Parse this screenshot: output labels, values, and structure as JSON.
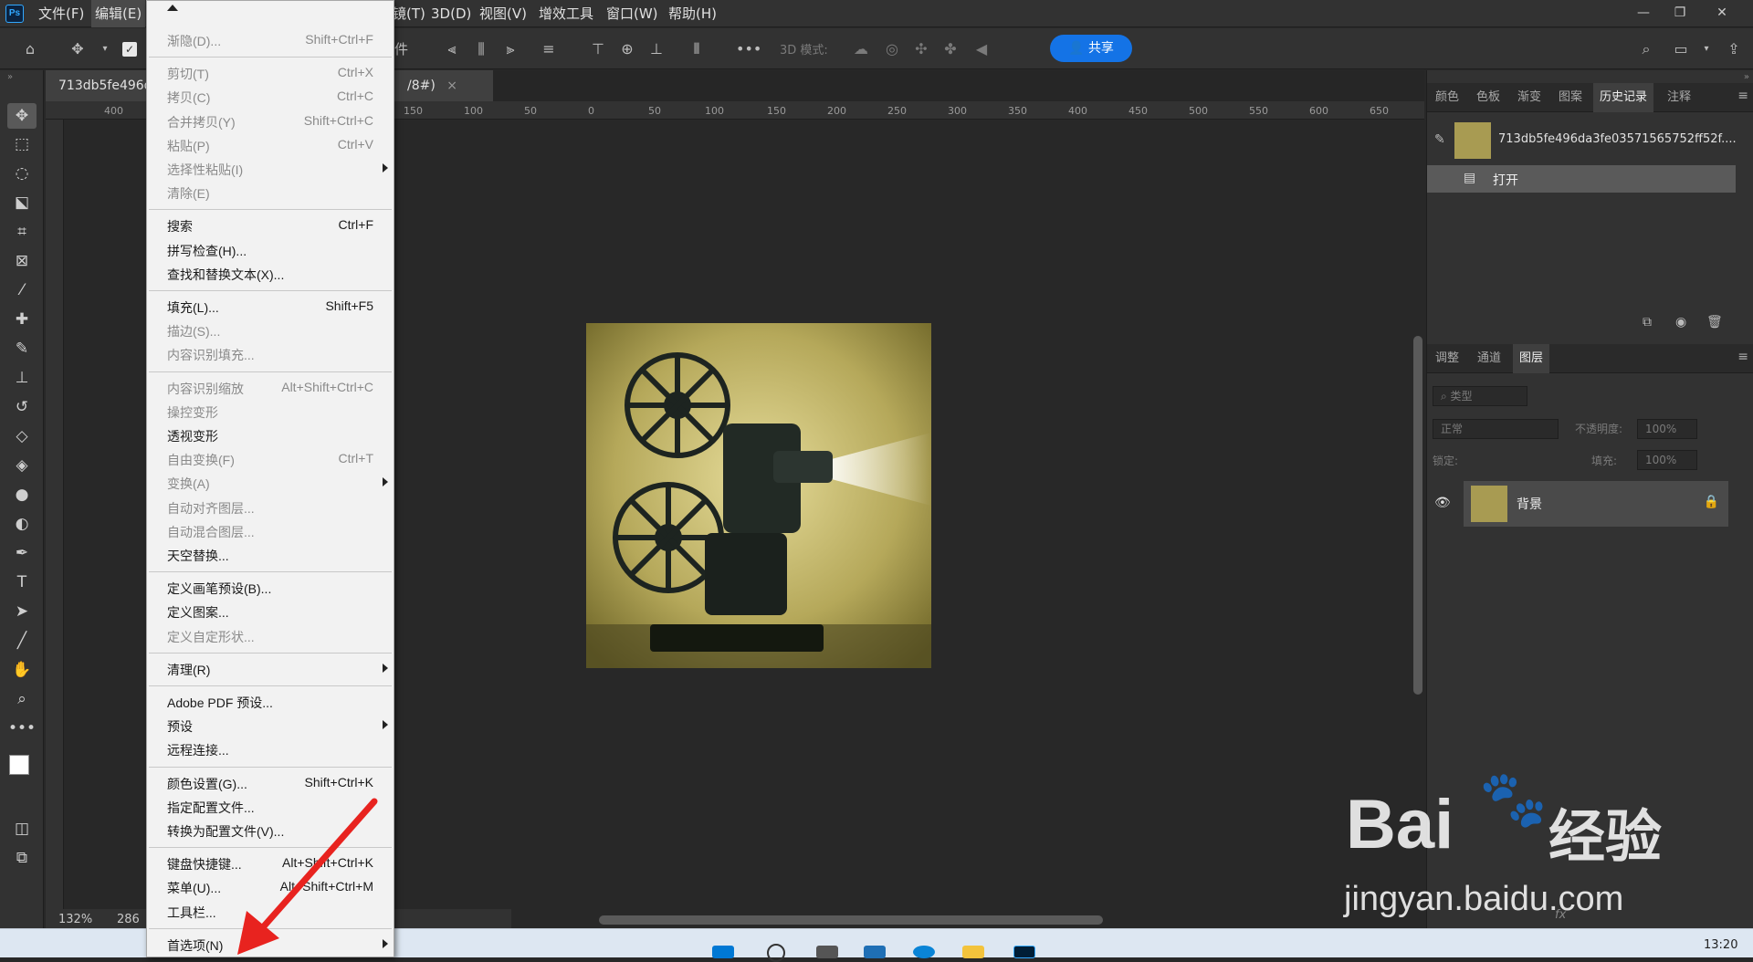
{
  "app": {
    "logo": "Ps"
  },
  "menubar": {
    "items": [
      "文件(F)",
      "编辑(E)",
      "滤镜(T)",
      "3D(D)",
      "视图(V)",
      "增效工具",
      "窗口(W)",
      "帮助(H)"
    ],
    "partial_item": "镜(T)"
  },
  "window_controls": {
    "minimize": "—",
    "restore": "❐",
    "close": "✕"
  },
  "options_bar": {
    "partial_text": "件",
    "mode_label": "3D 模式:",
    "share_label": "共享"
  },
  "document_tab": {
    "title_start": "713db5fe496d",
    "title_end": "/8#)",
    "close": "×"
  },
  "ruler": {
    "h_ticks": [
      "400",
      "350",
      "150",
      "100",
      "50",
      "0",
      "50",
      "100",
      "150",
      "200",
      "250",
      "300",
      "350",
      "400",
      "450",
      "500",
      "550",
      "600",
      "650"
    ]
  },
  "status": {
    "zoom": "132%",
    "size_partial": "286"
  },
  "dropdown": {
    "items": [
      {
        "label": "渐隐(D)...",
        "shortcut": "Shift+Ctrl+F",
        "disabled": true
      },
      {
        "sep": true
      },
      {
        "label": "剪切(T)",
        "shortcut": "Ctrl+X",
        "disabled": true
      },
      {
        "label": "拷贝(C)",
        "shortcut": "Ctrl+C",
        "disabled": true
      },
      {
        "label": "合并拷贝(Y)",
        "shortcut": "Shift+Ctrl+C",
        "disabled": true
      },
      {
        "label": "粘贴(P)",
        "shortcut": "Ctrl+V",
        "disabled": true
      },
      {
        "label": "选择性粘贴(I)",
        "shortcut": "",
        "disabled": true,
        "submenu": true
      },
      {
        "label": "清除(E)",
        "shortcut": "",
        "disabled": true
      },
      {
        "sep": true
      },
      {
        "label": "搜索",
        "shortcut": "Ctrl+F",
        "disabled": false
      },
      {
        "label": "拼写检查(H)...",
        "shortcut": "",
        "disabled": false
      },
      {
        "label": "查找和替换文本(X)...",
        "shortcut": "",
        "disabled": false
      },
      {
        "sep": true
      },
      {
        "label": "填充(L)...",
        "shortcut": "Shift+F5",
        "disabled": false
      },
      {
        "label": "描边(S)...",
        "shortcut": "",
        "disabled": true
      },
      {
        "label": "内容识别填充...",
        "shortcut": "",
        "disabled": true
      },
      {
        "sep": true
      },
      {
        "label": "内容识别缩放",
        "shortcut": "Alt+Shift+Ctrl+C",
        "disabled": true
      },
      {
        "label": "操控变形",
        "shortcut": "",
        "disabled": true
      },
      {
        "label": "透视变形",
        "shortcut": "",
        "disabled": false
      },
      {
        "label": "自由变换(F)",
        "shortcut": "Ctrl+T",
        "disabled": true
      },
      {
        "label": "变换(A)",
        "shortcut": "",
        "disabled": true,
        "submenu": true
      },
      {
        "label": "自动对齐图层...",
        "shortcut": "",
        "disabled": true
      },
      {
        "label": "自动混合图层...",
        "shortcut": "",
        "disabled": true
      },
      {
        "label": "天空替换...",
        "shortcut": "",
        "disabled": false
      },
      {
        "sep": true
      },
      {
        "label": "定义画笔预设(B)...",
        "shortcut": "",
        "disabled": false
      },
      {
        "label": "定义图案...",
        "shortcut": "",
        "disabled": false
      },
      {
        "label": "定义自定形状...",
        "shortcut": "",
        "disabled": true
      },
      {
        "sep": true
      },
      {
        "label": "清理(R)",
        "shortcut": "",
        "disabled": false,
        "submenu": true
      },
      {
        "sep": true
      },
      {
        "label": "Adobe PDF 预设...",
        "shortcut": "",
        "disabled": false
      },
      {
        "label": "预设",
        "shortcut": "",
        "disabled": false,
        "submenu": true
      },
      {
        "label": "远程连接...",
        "shortcut": "",
        "disabled": false
      },
      {
        "sep": true
      },
      {
        "label": "颜色设置(G)...",
        "shortcut": "Shift+Ctrl+K",
        "disabled": false
      },
      {
        "label": "指定配置文件...",
        "shortcut": "",
        "disabled": false
      },
      {
        "label": "转换为配置文件(V)...",
        "shortcut": "",
        "disabled": false
      },
      {
        "sep": true
      },
      {
        "label": "键盘快捷键...",
        "shortcut": "Alt+Shift+Ctrl+K",
        "disabled": false
      },
      {
        "label": "菜单(U)...",
        "shortcut": "Alt+Shift+Ctrl+M",
        "disabled": false
      },
      {
        "label": "工具栏...",
        "shortcut": "",
        "disabled": false
      },
      {
        "sep": true
      },
      {
        "label": "首选项(N)",
        "shortcut": "",
        "disabled": false,
        "submenu": true
      }
    ]
  },
  "panels": {
    "top_tabs": [
      "颜色",
      "色板",
      "渐变",
      "图案",
      "历史记录",
      "注释"
    ],
    "history": {
      "snapshot": "713db5fe496da3fe03571565752ff52f....",
      "step": "打开"
    },
    "layer_tabs": [
      "调整",
      "通道",
      "图层"
    ],
    "layer_controls": {
      "filter_type": "类型",
      "blend_mode": "正常",
      "opacity_label": "不透明度:",
      "opacity_value": "100%",
      "lock_label": "锁定:",
      "fill_label": "填充:",
      "fill_value": "100%"
    },
    "layer": {
      "name": "背景"
    },
    "footer_fx": "fx"
  },
  "watermark": {
    "brand": "Bai",
    "brand_cn": "经验",
    "url": "jingyan.baidu.com"
  },
  "taskbar": {
    "time": "13:20"
  },
  "colors": {
    "accent": "#1473e6",
    "arrow": "#e8231f",
    "ps_blue": "#31a8ff"
  }
}
